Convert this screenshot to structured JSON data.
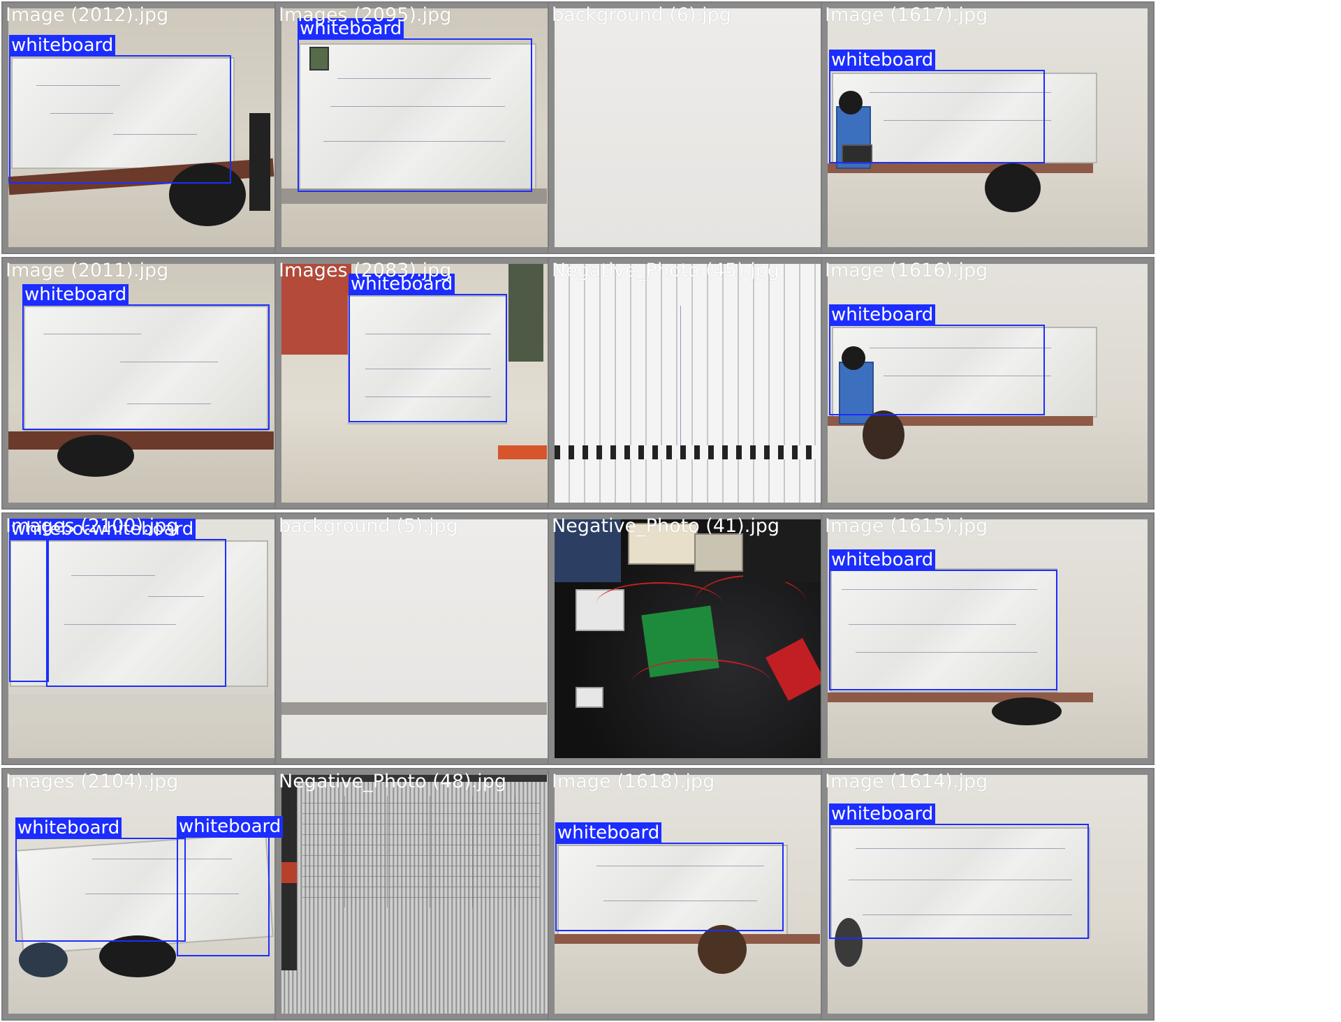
{
  "colors": {
    "box": "#1c2dff",
    "label_text": "#ffffff",
    "tile_border": "#7d7d7d"
  },
  "tiles": [
    {
      "filename": "Image (2012).jpg",
      "boxes": [
        {
          "label": "whiteboard"
        }
      ]
    },
    {
      "filename": "Images (2095).jpg",
      "boxes": [
        {
          "label": "whiteboard"
        }
      ]
    },
    {
      "filename": "background (6).jpg",
      "boxes": []
    },
    {
      "filename": "Image (1617).jpg",
      "boxes": [
        {
          "label": "whiteboard"
        }
      ]
    },
    {
      "filename": "Image (2011).jpg",
      "boxes": [
        {
          "label": "whiteboard"
        }
      ]
    },
    {
      "filename": "Images (2083).jpg",
      "boxes": [
        {
          "label": "whiteboard"
        }
      ]
    },
    {
      "filename": "Negative_Photo (45).jpg",
      "boxes": []
    },
    {
      "filename": "Image (1616).jpg",
      "boxes": [
        {
          "label": "whiteboard"
        }
      ]
    },
    {
      "filename": "Images (2100).jpg",
      "boxes": [
        {
          "label": "whiteboard"
        },
        {
          "label": "whiteboard"
        }
      ]
    },
    {
      "filename": "background (5).jpg",
      "boxes": []
    },
    {
      "filename": "Negative_Photo (41).jpg",
      "boxes": []
    },
    {
      "filename": "Image (1615).jpg",
      "boxes": [
        {
          "label": "whiteboard"
        }
      ]
    },
    {
      "filename": "Images (2104).jpg",
      "boxes": [
        {
          "label": "whiteboard"
        },
        {
          "label": "whiteboard"
        }
      ]
    },
    {
      "filename": "Negative_Photo (48).jpg",
      "boxes": []
    },
    {
      "filename": "Image (1618).jpg",
      "boxes": [
        {
          "label": "whiteboard"
        }
      ]
    },
    {
      "filename": "Image (1614).jpg",
      "boxes": [
        {
          "label": "whiteboard"
        }
      ]
    }
  ]
}
